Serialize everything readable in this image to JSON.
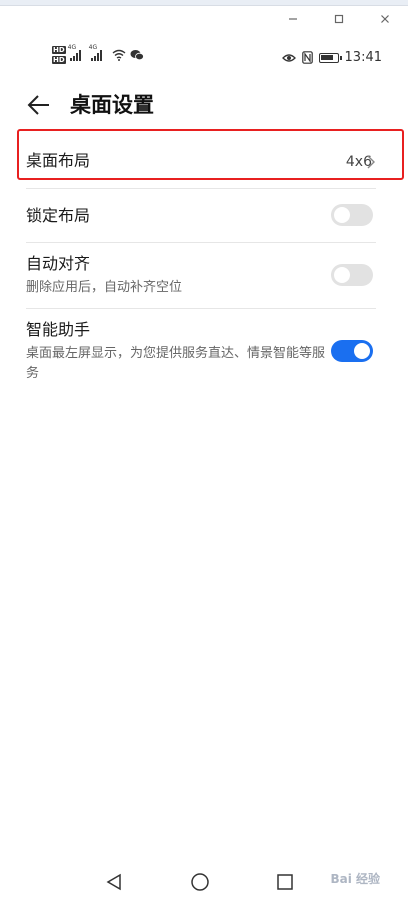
{
  "status_bar": {
    "network_tags": [
      "4G",
      "4G"
    ],
    "hd_labels": [
      "HD",
      "HD"
    ],
    "time": "13:41"
  },
  "header": {
    "title": "桌面设置"
  },
  "settings": [
    {
      "title": "桌面布局",
      "value": "4x6"
    },
    {
      "title": "锁定布局",
      "toggle": false
    },
    {
      "title": "自动对齐",
      "subtitle": "删除应用后，自动补齐空位",
      "toggle": false
    },
    {
      "title": "智能助手",
      "subtitle": "桌面最左屏显示，为您提供服务直达、情景智能等服务",
      "toggle": true
    }
  ],
  "colors": {
    "toggle_on": "#1a6ff0",
    "toggle_off": "#e2e2e2",
    "highlight": "#e82020"
  },
  "watermark": "Bai 经验"
}
